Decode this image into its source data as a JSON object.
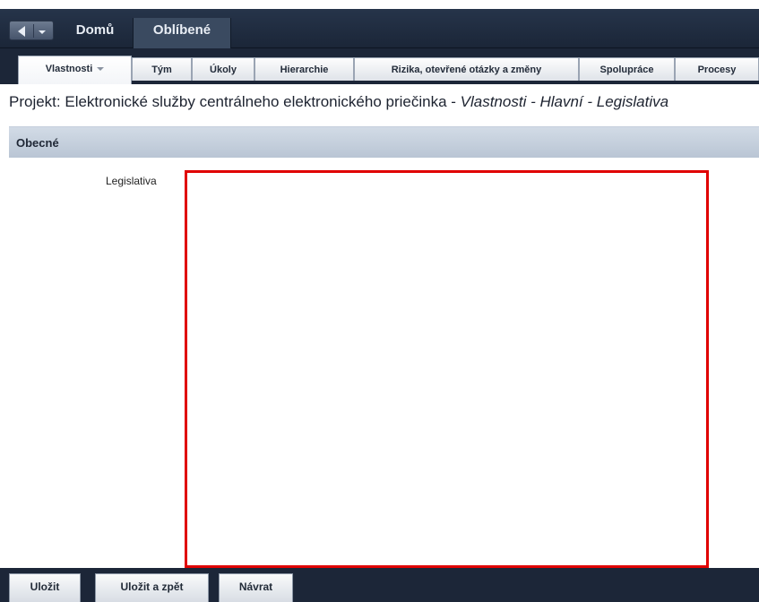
{
  "nav": {
    "home_label": "Domů",
    "favorites_label": "Oblíbené"
  },
  "tabs": [
    {
      "label": "Vlastnosti",
      "active": true,
      "has_dropdown": true
    },
    {
      "label": "Tým",
      "active": false
    },
    {
      "label": "Úkoly",
      "active": false
    },
    {
      "label": "Hierarchie",
      "active": false
    },
    {
      "label": "Rizika, otevřené otázky a změny",
      "active": false
    },
    {
      "label": "Spolupráce",
      "active": false
    },
    {
      "label": "Procesy",
      "active": false
    }
  ],
  "page": {
    "title_prefix": "Projekt: Elektronické služby centrálneho elektronického priečinka - ",
    "title_path": "Vlastnosti - Hlavní - Legislativa"
  },
  "section": {
    "title": "Obecné"
  },
  "form": {
    "legislativa_label": "Legislativa",
    "legislativa_value": ""
  },
  "toolbar": {
    "save_label": "Uložit",
    "save_back_label": "Uložit a zpět",
    "back_label": "Návrat"
  },
  "colors": {
    "nav_bg": "#1c2638",
    "highlight_border": "#e00000",
    "section_bg": "#c6d0dd"
  },
  "icons": {
    "back": "back-arrow-icon",
    "back_dropdown": "chevron-down-icon",
    "tab_dropdown": "chevron-down-icon"
  }
}
